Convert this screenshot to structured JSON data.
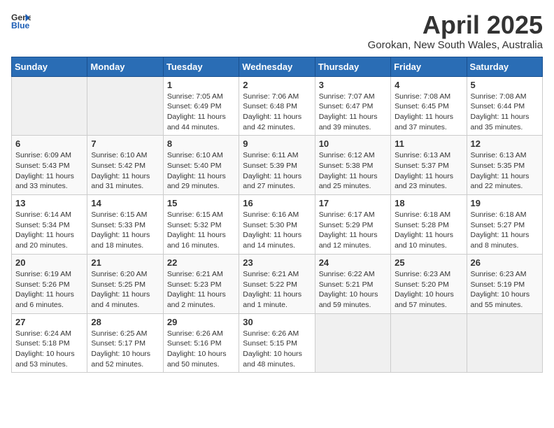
{
  "header": {
    "logo_general": "General",
    "logo_blue": "Blue",
    "month": "April 2025",
    "location": "Gorokan, New South Wales, Australia"
  },
  "days_of_week": [
    "Sunday",
    "Monday",
    "Tuesday",
    "Wednesday",
    "Thursday",
    "Friday",
    "Saturday"
  ],
  "weeks": [
    [
      {
        "day": "",
        "sunrise": "",
        "sunset": "",
        "daylight": ""
      },
      {
        "day": "",
        "sunrise": "",
        "sunset": "",
        "daylight": ""
      },
      {
        "day": "1",
        "sunrise": "Sunrise: 7:05 AM",
        "sunset": "Sunset: 6:49 PM",
        "daylight": "Daylight: 11 hours and 44 minutes."
      },
      {
        "day": "2",
        "sunrise": "Sunrise: 7:06 AM",
        "sunset": "Sunset: 6:48 PM",
        "daylight": "Daylight: 11 hours and 42 minutes."
      },
      {
        "day": "3",
        "sunrise": "Sunrise: 7:07 AM",
        "sunset": "Sunset: 6:47 PM",
        "daylight": "Daylight: 11 hours and 39 minutes."
      },
      {
        "day": "4",
        "sunrise": "Sunrise: 7:08 AM",
        "sunset": "Sunset: 6:45 PM",
        "daylight": "Daylight: 11 hours and 37 minutes."
      },
      {
        "day": "5",
        "sunrise": "Sunrise: 7:08 AM",
        "sunset": "Sunset: 6:44 PM",
        "daylight": "Daylight: 11 hours and 35 minutes."
      }
    ],
    [
      {
        "day": "6",
        "sunrise": "Sunrise: 6:09 AM",
        "sunset": "Sunset: 5:43 PM",
        "daylight": "Daylight: 11 hours and 33 minutes."
      },
      {
        "day": "7",
        "sunrise": "Sunrise: 6:10 AM",
        "sunset": "Sunset: 5:42 PM",
        "daylight": "Daylight: 11 hours and 31 minutes."
      },
      {
        "day": "8",
        "sunrise": "Sunrise: 6:10 AM",
        "sunset": "Sunset: 5:40 PM",
        "daylight": "Daylight: 11 hours and 29 minutes."
      },
      {
        "day": "9",
        "sunrise": "Sunrise: 6:11 AM",
        "sunset": "Sunset: 5:39 PM",
        "daylight": "Daylight: 11 hours and 27 minutes."
      },
      {
        "day": "10",
        "sunrise": "Sunrise: 6:12 AM",
        "sunset": "Sunset: 5:38 PM",
        "daylight": "Daylight: 11 hours and 25 minutes."
      },
      {
        "day": "11",
        "sunrise": "Sunrise: 6:13 AM",
        "sunset": "Sunset: 5:37 PM",
        "daylight": "Daylight: 11 hours and 23 minutes."
      },
      {
        "day": "12",
        "sunrise": "Sunrise: 6:13 AM",
        "sunset": "Sunset: 5:35 PM",
        "daylight": "Daylight: 11 hours and 22 minutes."
      }
    ],
    [
      {
        "day": "13",
        "sunrise": "Sunrise: 6:14 AM",
        "sunset": "Sunset: 5:34 PM",
        "daylight": "Daylight: 11 hours and 20 minutes."
      },
      {
        "day": "14",
        "sunrise": "Sunrise: 6:15 AM",
        "sunset": "Sunset: 5:33 PM",
        "daylight": "Daylight: 11 hours and 18 minutes."
      },
      {
        "day": "15",
        "sunrise": "Sunrise: 6:15 AM",
        "sunset": "Sunset: 5:32 PM",
        "daylight": "Daylight: 11 hours and 16 minutes."
      },
      {
        "day": "16",
        "sunrise": "Sunrise: 6:16 AM",
        "sunset": "Sunset: 5:30 PM",
        "daylight": "Daylight: 11 hours and 14 minutes."
      },
      {
        "day": "17",
        "sunrise": "Sunrise: 6:17 AM",
        "sunset": "Sunset: 5:29 PM",
        "daylight": "Daylight: 11 hours and 12 minutes."
      },
      {
        "day": "18",
        "sunrise": "Sunrise: 6:18 AM",
        "sunset": "Sunset: 5:28 PM",
        "daylight": "Daylight: 11 hours and 10 minutes."
      },
      {
        "day": "19",
        "sunrise": "Sunrise: 6:18 AM",
        "sunset": "Sunset: 5:27 PM",
        "daylight": "Daylight: 11 hours and 8 minutes."
      }
    ],
    [
      {
        "day": "20",
        "sunrise": "Sunrise: 6:19 AM",
        "sunset": "Sunset: 5:26 PM",
        "daylight": "Daylight: 11 hours and 6 minutes."
      },
      {
        "day": "21",
        "sunrise": "Sunrise: 6:20 AM",
        "sunset": "Sunset: 5:25 PM",
        "daylight": "Daylight: 11 hours and 4 minutes."
      },
      {
        "day": "22",
        "sunrise": "Sunrise: 6:21 AM",
        "sunset": "Sunset: 5:23 PM",
        "daylight": "Daylight: 11 hours and 2 minutes."
      },
      {
        "day": "23",
        "sunrise": "Sunrise: 6:21 AM",
        "sunset": "Sunset: 5:22 PM",
        "daylight": "Daylight: 11 hours and 1 minute."
      },
      {
        "day": "24",
        "sunrise": "Sunrise: 6:22 AM",
        "sunset": "Sunset: 5:21 PM",
        "daylight": "Daylight: 10 hours and 59 minutes."
      },
      {
        "day": "25",
        "sunrise": "Sunrise: 6:23 AM",
        "sunset": "Sunset: 5:20 PM",
        "daylight": "Daylight: 10 hours and 57 minutes."
      },
      {
        "day": "26",
        "sunrise": "Sunrise: 6:23 AM",
        "sunset": "Sunset: 5:19 PM",
        "daylight": "Daylight: 10 hours and 55 minutes."
      }
    ],
    [
      {
        "day": "27",
        "sunrise": "Sunrise: 6:24 AM",
        "sunset": "Sunset: 5:18 PM",
        "daylight": "Daylight: 10 hours and 53 minutes."
      },
      {
        "day": "28",
        "sunrise": "Sunrise: 6:25 AM",
        "sunset": "Sunset: 5:17 PM",
        "daylight": "Daylight: 10 hours and 52 minutes."
      },
      {
        "day": "29",
        "sunrise": "Sunrise: 6:26 AM",
        "sunset": "Sunset: 5:16 PM",
        "daylight": "Daylight: 10 hours and 50 minutes."
      },
      {
        "day": "30",
        "sunrise": "Sunrise: 6:26 AM",
        "sunset": "Sunset: 5:15 PM",
        "daylight": "Daylight: 10 hours and 48 minutes."
      },
      {
        "day": "",
        "sunrise": "",
        "sunset": "",
        "daylight": ""
      },
      {
        "day": "",
        "sunrise": "",
        "sunset": "",
        "daylight": ""
      },
      {
        "day": "",
        "sunrise": "",
        "sunset": "",
        "daylight": ""
      }
    ]
  ]
}
